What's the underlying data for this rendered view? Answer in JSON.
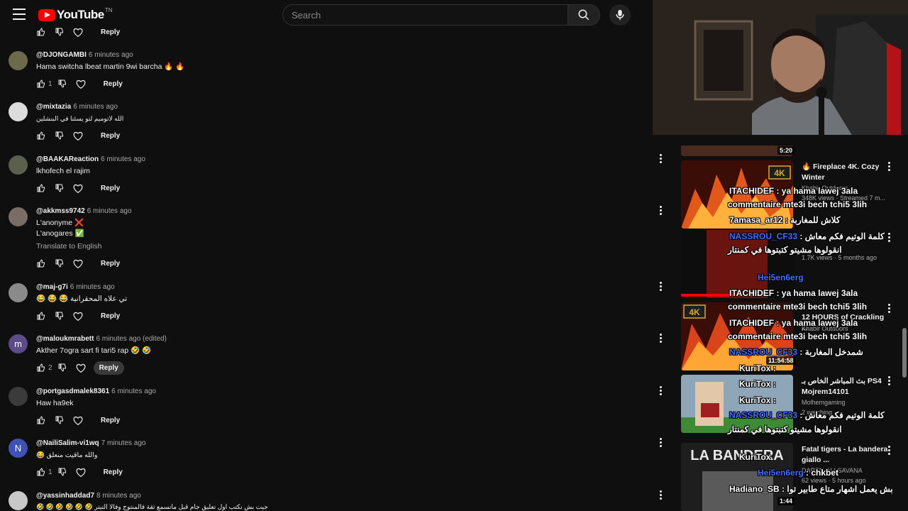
{
  "header": {
    "logo_text": "YouTube",
    "logo_region": "TN",
    "search_placeholder": "Search"
  },
  "reply_label": "Reply",
  "comments": [
    {
      "author": "@DJONGAMBI",
      "time": "6 minutes ago",
      "text": "Hama switcha lbeat martin 9wi barcha 🔥 🔥",
      "likes": "1"
    },
    {
      "author": "@mixtazia",
      "time": "6 minutes ago",
      "text": "الله لاتوميم لتو يسئنا في البنشلين",
      "likes": ""
    },
    {
      "author": "@BAAKAReaction",
      "time": "6 minutes ago",
      "text": "lkhofech el rajim",
      "likes": ""
    },
    {
      "author": "@akkmss9742",
      "time": "6 minutes ago",
      "text": "L'anonyme ❌",
      "text2": "L'anogares ✅",
      "translate": "Translate to English",
      "likes": ""
    },
    {
      "author": "@maj-g7i",
      "time": "6 minutes ago",
      "text": "😂 😂 😂 تي علاه المحقرانية",
      "likes": ""
    },
    {
      "author": "@maloukmrabett",
      "time": "6 minutes ago (edited)",
      "text": "Akther 7ogra sart fi tari5 rap 🤣 🤣",
      "likes": "2",
      "avatar_letter": "m"
    },
    {
      "author": "@portgasdmalek8361",
      "time": "6 minutes ago",
      "text": "Haw ha9ek",
      "likes": ""
    },
    {
      "author": "@NailiSalim-vi1wq",
      "time": "7 minutes ago",
      "text": "😂 والله ماقيت منعلق",
      "likes": "1",
      "avatar_letter": "N"
    },
    {
      "author": "@yassinhaddad7",
      "time": "8 minutes ago",
      "text": "🤣 🤣 🤣 🤣 🤣 🤣 جيت بش نكتب اول تعليق جام قبل مانسمع ثقة فالمنتوج وفالا التيتر",
      "likes": ""
    }
  ],
  "sidebar": {
    "webcam_duration": "5:20",
    "videos": [
      {
        "title": "🔥 Fireplace 4K. Cozy Winter",
        "channel": "Khabir Outdoors",
        "meta": "348K views · Streamed 7 m..."
      },
      {
        "title": "",
        "channel": "",
        "meta": "1.7K views · 5 months ago"
      },
      {
        "title": "12 HOURS of Crackling ...",
        "channel": "Khabir Outdoors",
        "duration": "11:54:58"
      },
      {
        "title": "بث المباشر الخاص بـ PS4 Mojrem14101",
        "channel": "Molhemgaming",
        "meta": "2 watching"
      },
      {
        "title": "Fatal tigers - La bandera giallo ...",
        "channel": "DAREN-ALI SAVANA",
        "meta": "62 views · 5 hours ago",
        "duration": "1:44"
      }
    ],
    "chat": [
      {
        "user": "ITACHIDEF",
        "msg": " : ya hama lawej 3ala"
      },
      {
        "user": "",
        "msg": "commentaire mte3i bech tchi5 3lih"
      },
      {
        "user": "7amasa_ar12",
        "msg": " : كلاش للمغاربة"
      },
      {
        "user": "NASSROU_CF33",
        "msg": " : كلمة الوتيم فكم معاش"
      },
      {
        "user": "",
        "msg": "انقولوها مشيتو كتبتوها في كمنتار"
      },
      {
        "user": "Hei5en6erg",
        "msg": ""
      },
      {
        "user": "ITACHIDEF",
        "msg": " : ya hama lawej 3ala"
      },
      {
        "user": "",
        "msg": "commentaire mte3i bech tchi5 3lih"
      },
      {
        "user": "ITACHIDEF",
        "msg": " : ya hama lawej 3ala"
      },
      {
        "user": "",
        "msg": "commentaire mte3i bech tchi5 3lih"
      },
      {
        "user": "NASSROU_CF33",
        "msg": " : شمدخل المغاربة"
      },
      {
        "user": "KuriTox",
        "msg": " :"
      },
      {
        "user": "KuriTox",
        "msg": " :"
      },
      {
        "user": "KuriTox",
        "msg": " :"
      },
      {
        "user": "NASSROU_CF33",
        "msg": " : كلمة الوتيم فكم معاش"
      },
      {
        "user": "",
        "msg": "انقولوها مشيتو كتبتوها في كمنتار"
      },
      {
        "user": "KuriTox",
        "msg": ""
      },
      {
        "user": "Hei5en6erg",
        "msg": " : chkbet"
      },
      {
        "user": "Hadiano_SB",
        "msg": " : بش يعمل اشهار متاع طابير توا"
      }
    ]
  },
  "colors": {
    "background": "#0f0f0f",
    "youtube_red": "#ff0000",
    "chat_blue": "#3f6fff"
  }
}
